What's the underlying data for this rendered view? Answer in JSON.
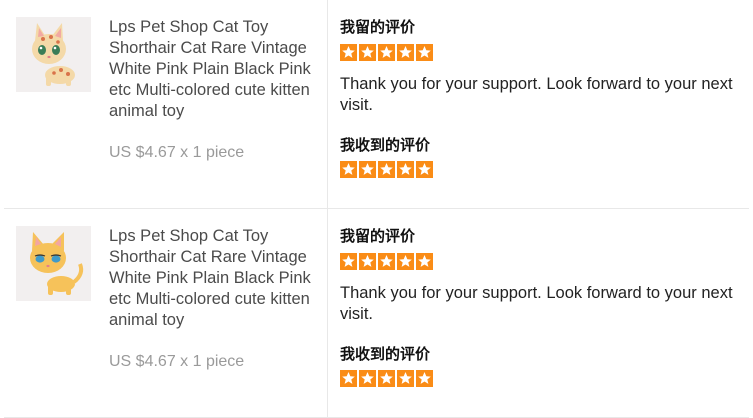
{
  "reviews": [
    {
      "product_title": "Lps Pet Shop Cat Toy Shorthair Cat Rare Vintage White Pink Plain Black Pink etc Multi-colored cute kitten animal toy",
      "price": "US $4.67 x 1 piece",
      "image_icon": "cat-toy-spotted-icon",
      "my_review_label": "我留的评价",
      "my_rating": 5,
      "review_text": "Thank you for your support. Look forward to your next visit.",
      "received_review_label": "我收到的评价",
      "received_rating": 5
    },
    {
      "product_title": "Lps Pet Shop Cat Toy Shorthair Cat Rare Vintage White Pink Plain Black Pink etc Multi-colored cute kitten animal toy",
      "price": "US $4.67 x 1 piece",
      "image_icon": "cat-toy-yellow-icon",
      "my_review_label": "我留的评价",
      "my_rating": 5,
      "review_text": "Thank you for your support. Look forward to your next visit.",
      "received_review_label": "我收到的评价",
      "received_rating": 5
    }
  ],
  "colors": {
    "star": "#fa8c16",
    "divider": "#e8e8e8",
    "title_text": "#4b4b4b",
    "price_text": "#9a9a9a"
  }
}
